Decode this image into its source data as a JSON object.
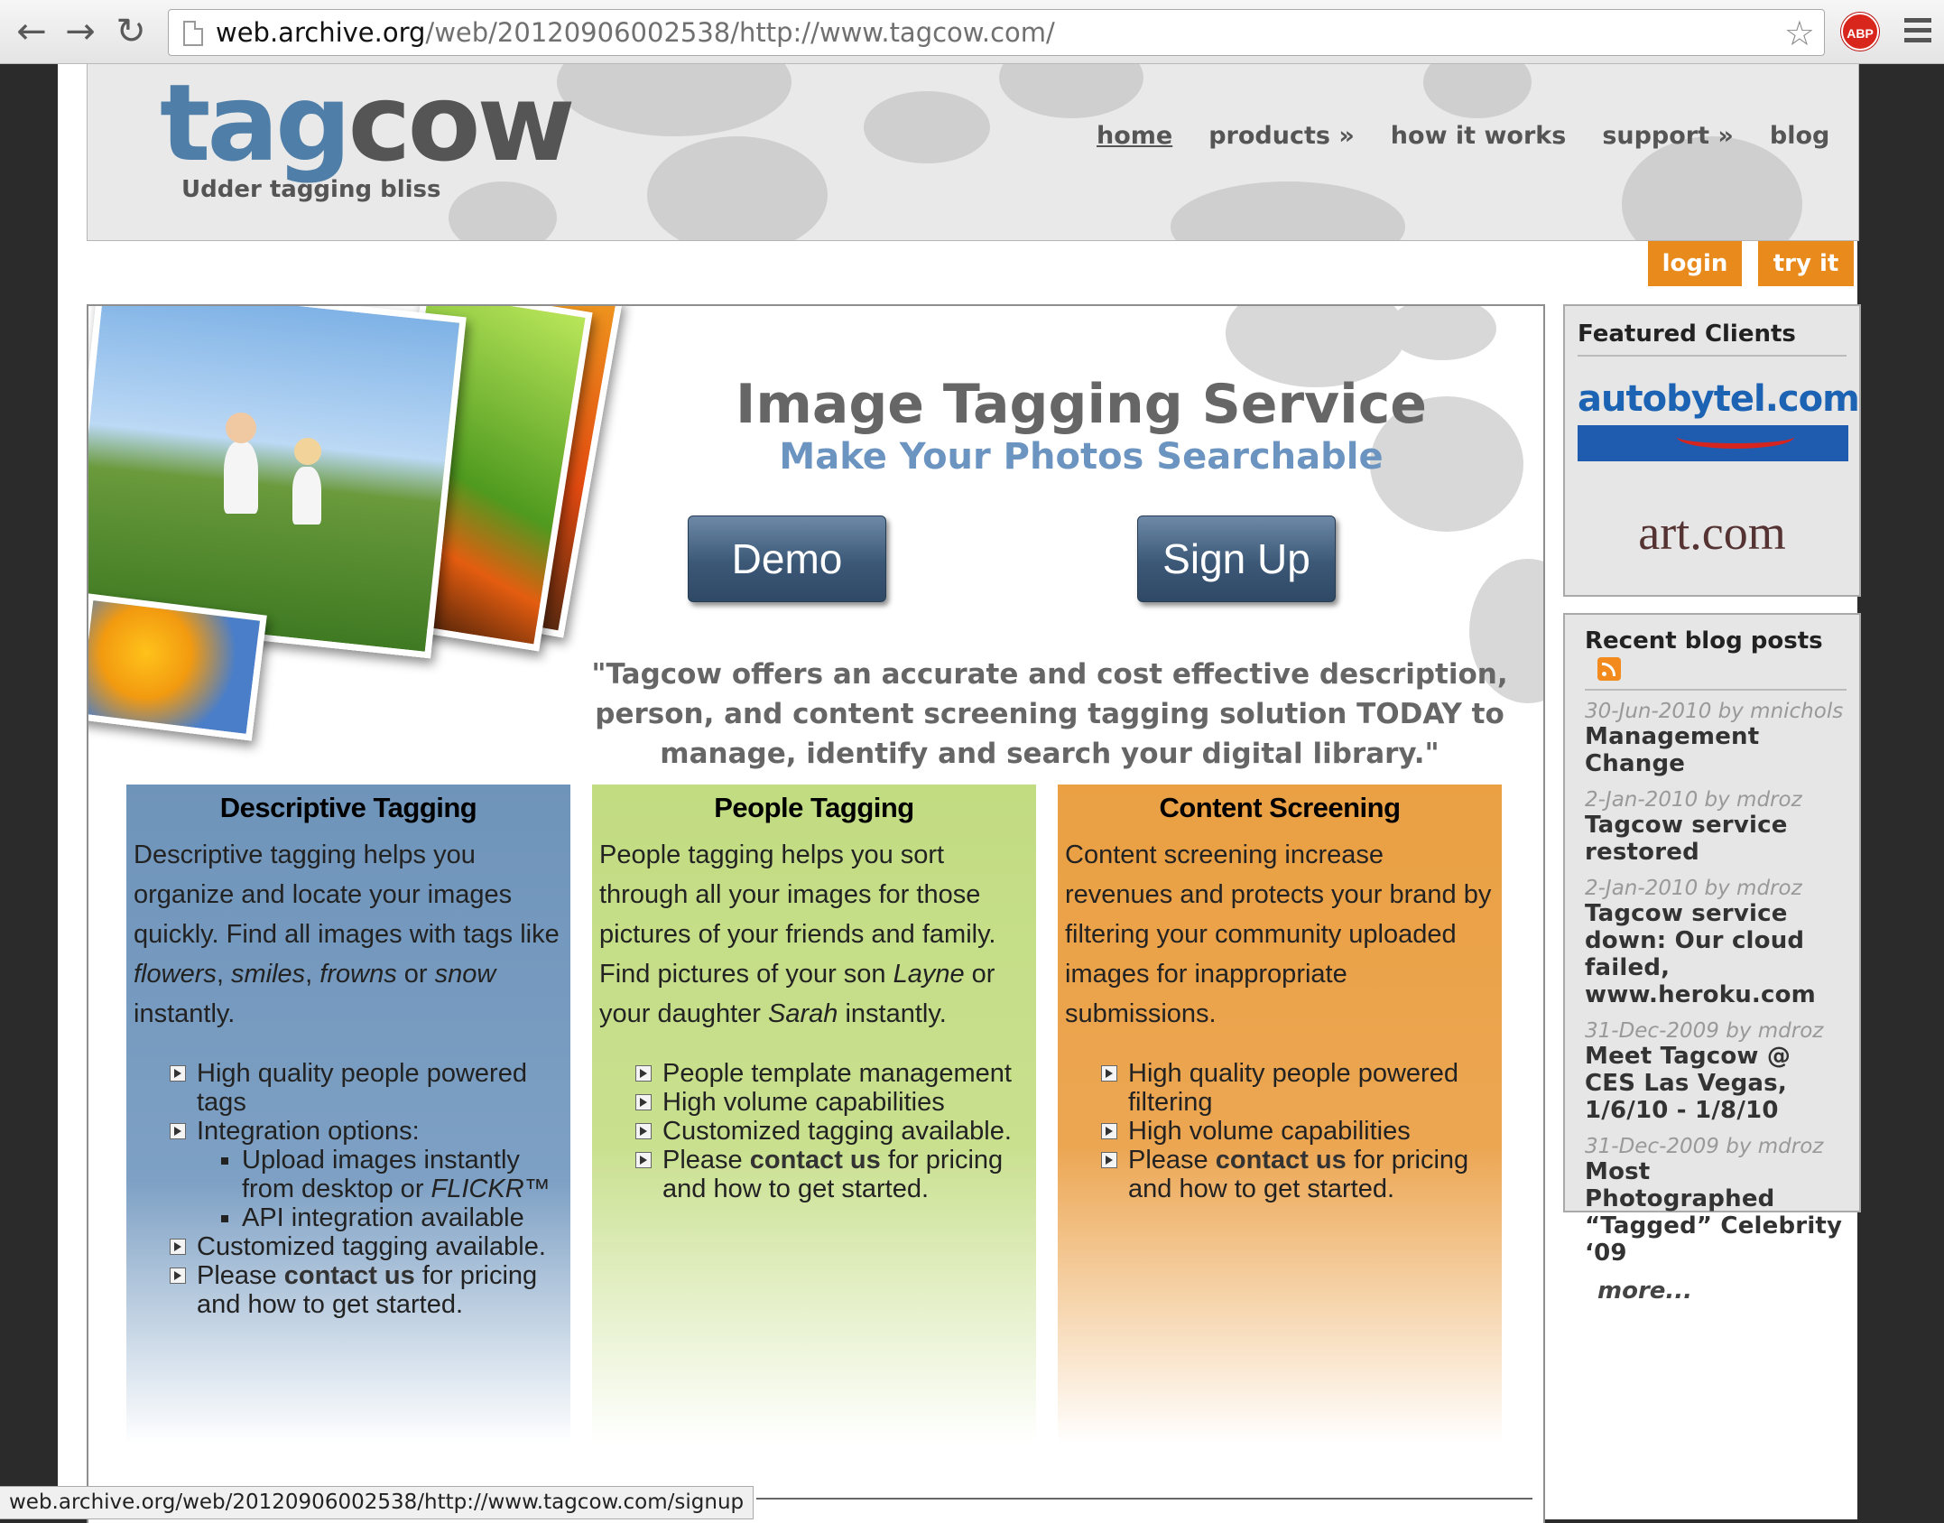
{
  "browser": {
    "url_host": "web.archive.org",
    "url_path": "/web/20120906002538/http://www.tagcow.com/",
    "back_icon": "arrow-left-icon",
    "forward_icon": "arrow-right-icon",
    "reload_icon": "reload-icon",
    "abp_label": "ABP",
    "status_url": "web.archive.org/web/20120906002538/http://www.tagcow.com/signup"
  },
  "header": {
    "logo_tag": "tag",
    "logo_cow": "cow",
    "tagline": "Udder tagging bliss",
    "nav": [
      "home",
      "products »",
      "how it works",
      "support »",
      "blog"
    ]
  },
  "account": {
    "login": "login",
    "try_it": "try it"
  },
  "hero": {
    "title": "Image Tagging Service",
    "subtitle": "Make Your Photos Searchable",
    "demo": "Demo",
    "signup": "Sign Up",
    "quote": "\"Tagcow offers an accurate and cost effective description, person, and content screening tagging solution TODAY to manage, identify and search your digital library.\""
  },
  "columns": {
    "descriptive": {
      "title": "Descriptive Tagging",
      "p1": "Descriptive tagging helps you organize and locate your images quickly. Find all images with tags like ",
      "w1": "flowers",
      "c1": ", ",
      "w2": "smiles",
      "c2": ", ",
      "w3": "frowns",
      "c3": " or ",
      "w4": "snow",
      "p2": " instantly.",
      "b1": "High quality people powered tags",
      "b2": "Integration options:",
      "s1": "Upload images instantly from desktop or ",
      "s1b": "FLICKR™",
      "s2": "API integration available",
      "b3": "Customized tagging available.",
      "b4a": "Please ",
      "b4link": "contact us",
      "b4b": " for pricing and how to get started."
    },
    "people": {
      "title": "People Tagging",
      "p1": "People tagging helps you sort through all your images for those pictures of your friends and family. Find pictures of your son ",
      "n1": "Layne",
      "p2": " or your daughter ",
      "n2": "Sarah",
      "p3": " instantly.",
      "b1": "People template management",
      "b2": "High volume capabilities",
      "b3": "Customized tagging available.",
      "b4a": "Please ",
      "b4link": "contact us",
      "b4b": " for pricing and how to get started."
    },
    "content": {
      "title": "Content Screening",
      "p1": "Content screening increase revenues and protects your brand by filtering your community uploaded images for inappropriate submissions.",
      "b1": "High quality people powered filtering",
      "b2": "High volume capabilities",
      "b3a": "Please ",
      "b3link": "contact us",
      "b3b": " for pricing and how to get started."
    }
  },
  "featured": {
    "title": "Featured Clients",
    "client1": "autobytel.com",
    "client2": "art.com"
  },
  "blog": {
    "title": "Recent blog posts",
    "rss_icon": "rss-icon",
    "posts": [
      {
        "meta": "30-Jun-2010 by mnichols",
        "title": "Management Change"
      },
      {
        "meta": "2-Jan-2010 by mdroz",
        "title": "Tagcow service restored"
      },
      {
        "meta": "2-Jan-2010 by mdroz",
        "title": "Tagcow service down: Our cloud failed, www.heroku.com"
      },
      {
        "meta": "31-Dec-2009 by mdroz",
        "title": "Meet Tagcow @ CES Las Vegas, 1/6/10 - 1/8/10"
      },
      {
        "meta": "31-Dec-2009 by mdroz",
        "title": "Most Photographed “Tagged” Celebrity ‘09"
      }
    ],
    "more": "more..."
  },
  "colors": {
    "brand_blue": "#4f7fa8",
    "accent_orange": "#e88a1c",
    "button_navy": "#3c5877"
  }
}
